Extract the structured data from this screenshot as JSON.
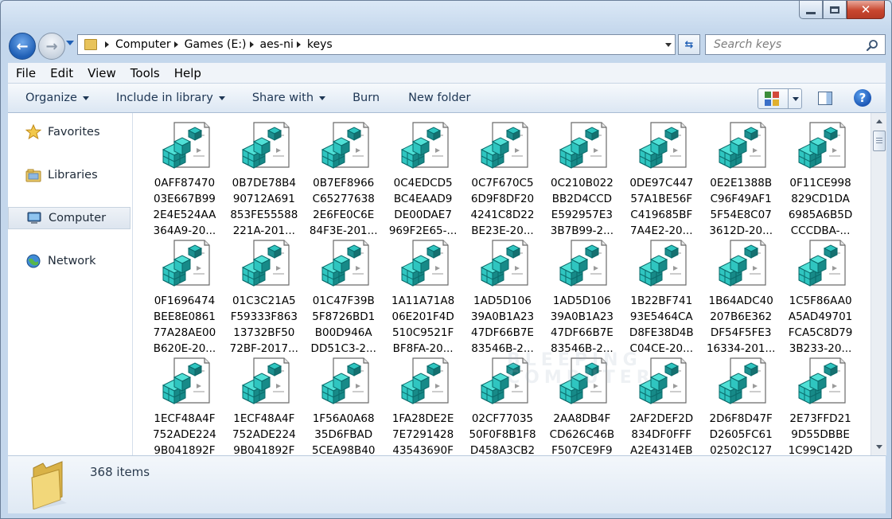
{
  "address": {
    "crumbs": [
      "Computer",
      "Games (E:)",
      "aes-ni",
      "keys"
    ]
  },
  "search": {
    "placeholder": "Search keys"
  },
  "menu": [
    "File",
    "Edit",
    "View",
    "Tools",
    "Help"
  ],
  "commands": {
    "organize": "Organize",
    "include_in_library": "Include in library",
    "share_with": "Share with",
    "burn": "Burn",
    "new_folder": "New folder"
  },
  "nav": {
    "favorites": "Favorites",
    "libraries": "Libraries",
    "computer": "Computer",
    "network": "Network"
  },
  "files": [
    [
      "0AFF87470",
      "03E667B99",
      "2E4E524AA",
      "364A9-20..."
    ],
    [
      "0B7DE78B4",
      "90712A691",
      "853FE55588",
      "221A-201..."
    ],
    [
      "0B7EF8966",
      "C65277638",
      "2E6FE0C6E",
      "84F3E-201..."
    ],
    [
      "0C4EDCD5",
      "BC4EAAD9",
      "DE00DAE7",
      "969F2E65-..."
    ],
    [
      "0C7F670C5",
      "6D9F8DF20",
      "4241C8D22",
      "BE23E-20..."
    ],
    [
      "0C210B022",
      "BB2D4CCD",
      "E592957E3",
      "3B7B99-2..."
    ],
    [
      "0DE97C447",
      "57A1BE56F",
      "C419685BF",
      "7A4E2-20..."
    ],
    [
      "0E2E1388B",
      "C96F49AF1",
      "5F54E8C07",
      "3612D-20..."
    ],
    [
      "0F11CE998",
      "829CD1DA",
      "6985A6B5D",
      "CCCDBA-..."
    ],
    [
      "0F1696474",
      "BEE8E0861",
      "77A28AE00",
      "B620E-20..."
    ],
    [
      "01C3C21A5",
      "F59333F863",
      "13732BF50",
      "72BF-2017..."
    ],
    [
      "01C47F39B",
      "5F8726BD1",
      "B00D946A",
      "DD51C3-2..."
    ],
    [
      "1A11A71A8",
      "06E201F4D",
      "510C9521F",
      "BF8FA-20..."
    ],
    [
      "1AD5D106",
      "39A0B1A23",
      "47DF66B7E",
      "83546B-2..."
    ],
    [
      "1AD5D106",
      "39A0B1A23",
      "47DF66B7E",
      "83546B-2..."
    ],
    [
      "1B22BF741",
      "93E5464CA",
      "D8FE38D4B",
      "C04CE-20..."
    ],
    [
      "1B64ADC40",
      "207B6E362",
      "DF54F5FE3",
      "16334-201..."
    ],
    [
      "1C5F86AA0",
      "A5AD49701",
      "FCA5C8D79",
      "3B233-20..."
    ],
    [
      "1ECF48A4F",
      "752ADE224",
      "9B041892F",
      ""
    ],
    [
      "1ECF48A4F",
      "752ADE224",
      "9B041892F",
      ""
    ],
    [
      "1F56A0A68",
      "35D6FBAD",
      "5CEA98B40",
      ""
    ],
    [
      "1FA28DE2E",
      "7E7291428",
      "43543690F",
      ""
    ],
    [
      "02CF77035",
      "50F0F8B1F8",
      "D458A3CB2",
      ""
    ],
    [
      "2AA8DB4F",
      "CD626C46B",
      "F507CE9F9",
      ""
    ],
    [
      "2AF2DEF2D",
      "834DF0FFF",
      "A2E4314EB",
      ""
    ],
    [
      "2D6F8D47F",
      "D2605FC61",
      "02502C127",
      ""
    ],
    [
      "2E73FFD21",
      "9D55DBBE",
      "1C99C142D",
      ""
    ]
  ],
  "watermark": [
    "BLEEPING",
    "COMPUTER"
  ],
  "details": {
    "count": "368 items"
  },
  "colors": {
    "accent": "#1f5fb5",
    "icon_cyan": "#2fc5c0",
    "icon_dark": "#0a6a6a"
  }
}
